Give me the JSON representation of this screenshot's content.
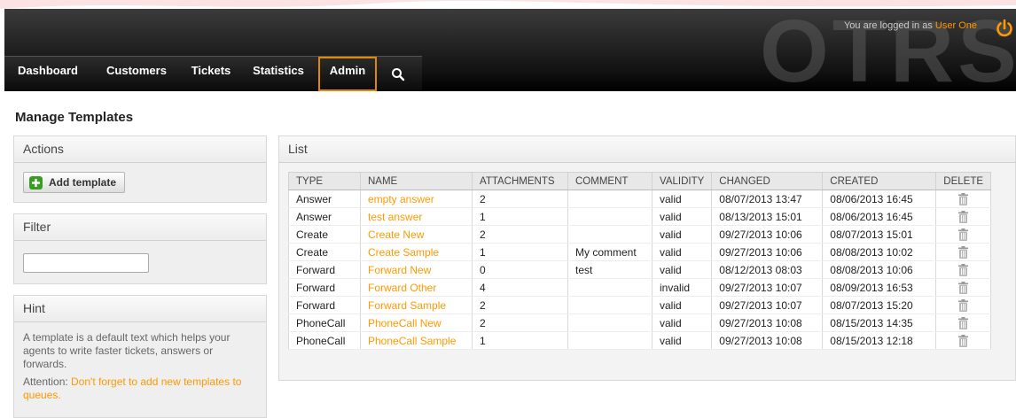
{
  "header": {
    "logo_text": "OTRS",
    "login_prefix": "You are logged in as",
    "user_name": "User One"
  },
  "nav": {
    "items": [
      {
        "label": "Dashboard"
      },
      {
        "label": "Customers"
      },
      {
        "label": "Tickets"
      },
      {
        "label": "Statistics"
      },
      {
        "label": "Admin",
        "active": true
      }
    ]
  },
  "page": {
    "title": "Manage Templates"
  },
  "sidebar": {
    "actions": {
      "title": "Actions",
      "add_button_label": "Add template"
    },
    "filter": {
      "title": "Filter",
      "value": ""
    },
    "hint": {
      "title": "Hint",
      "text": "A template is a default text which helps your agents to write faster tickets, answers or forwards.",
      "attention_prefix": "Attention:",
      "attention_link": "Don't forget to add new templates to queues."
    }
  },
  "list": {
    "title": "List",
    "columns": [
      "TYPE",
      "NAME",
      "ATTACHMENTS",
      "COMMENT",
      "VALIDITY",
      "CHANGED",
      "CREATED",
      "DELETE"
    ],
    "rows": [
      {
        "type": "Answer",
        "name": "empty answer",
        "attachments": "2",
        "comment": "",
        "validity": "valid",
        "changed": "08/07/2013 13:47",
        "created": "08/06/2013 16:45"
      },
      {
        "type": "Answer",
        "name": "test answer",
        "attachments": "1",
        "comment": "",
        "validity": "valid",
        "changed": "08/13/2013 15:01",
        "created": "08/06/2013 16:45"
      },
      {
        "type": "Create",
        "name": "Create New",
        "attachments": "2",
        "comment": "",
        "validity": "valid",
        "changed": "09/27/2013 10:06",
        "created": "08/07/2013 15:01"
      },
      {
        "type": "Create",
        "name": "Create Sample",
        "attachments": "1",
        "comment": "My comment",
        "validity": "valid",
        "changed": "09/27/2013 10:06",
        "created": "08/08/2013 10:02"
      },
      {
        "type": "Forward",
        "name": "Forward New",
        "attachments": "0",
        "comment": "test",
        "validity": "valid",
        "changed": "08/12/2013 08:03",
        "created": "08/08/2013 10:06"
      },
      {
        "type": "Forward",
        "name": "Forward Other",
        "attachments": "4",
        "comment": "",
        "validity": "invalid",
        "changed": "09/27/2013 10:07",
        "created": "08/09/2013 16:53"
      },
      {
        "type": "Forward",
        "name": "Forward Sample",
        "attachments": "2",
        "comment": "",
        "validity": "valid",
        "changed": "09/27/2013 10:07",
        "created": "08/07/2013 15:20"
      },
      {
        "type": "PhoneCall",
        "name": "PhoneCall New",
        "attachments": "2",
        "comment": "",
        "validity": "valid",
        "changed": "09/27/2013 10:08",
        "created": "08/15/2013 14:35"
      },
      {
        "type": "PhoneCall",
        "name": "PhoneCall Sample",
        "attachments": "1",
        "comment": "",
        "validity": "valid",
        "changed": "09/27/2013 10:08",
        "created": "08/15/2013 12:18"
      }
    ]
  },
  "colors": {
    "accent": "#ff9900",
    "header_bg": "#000000",
    "add_icon": "#3a9d23"
  }
}
